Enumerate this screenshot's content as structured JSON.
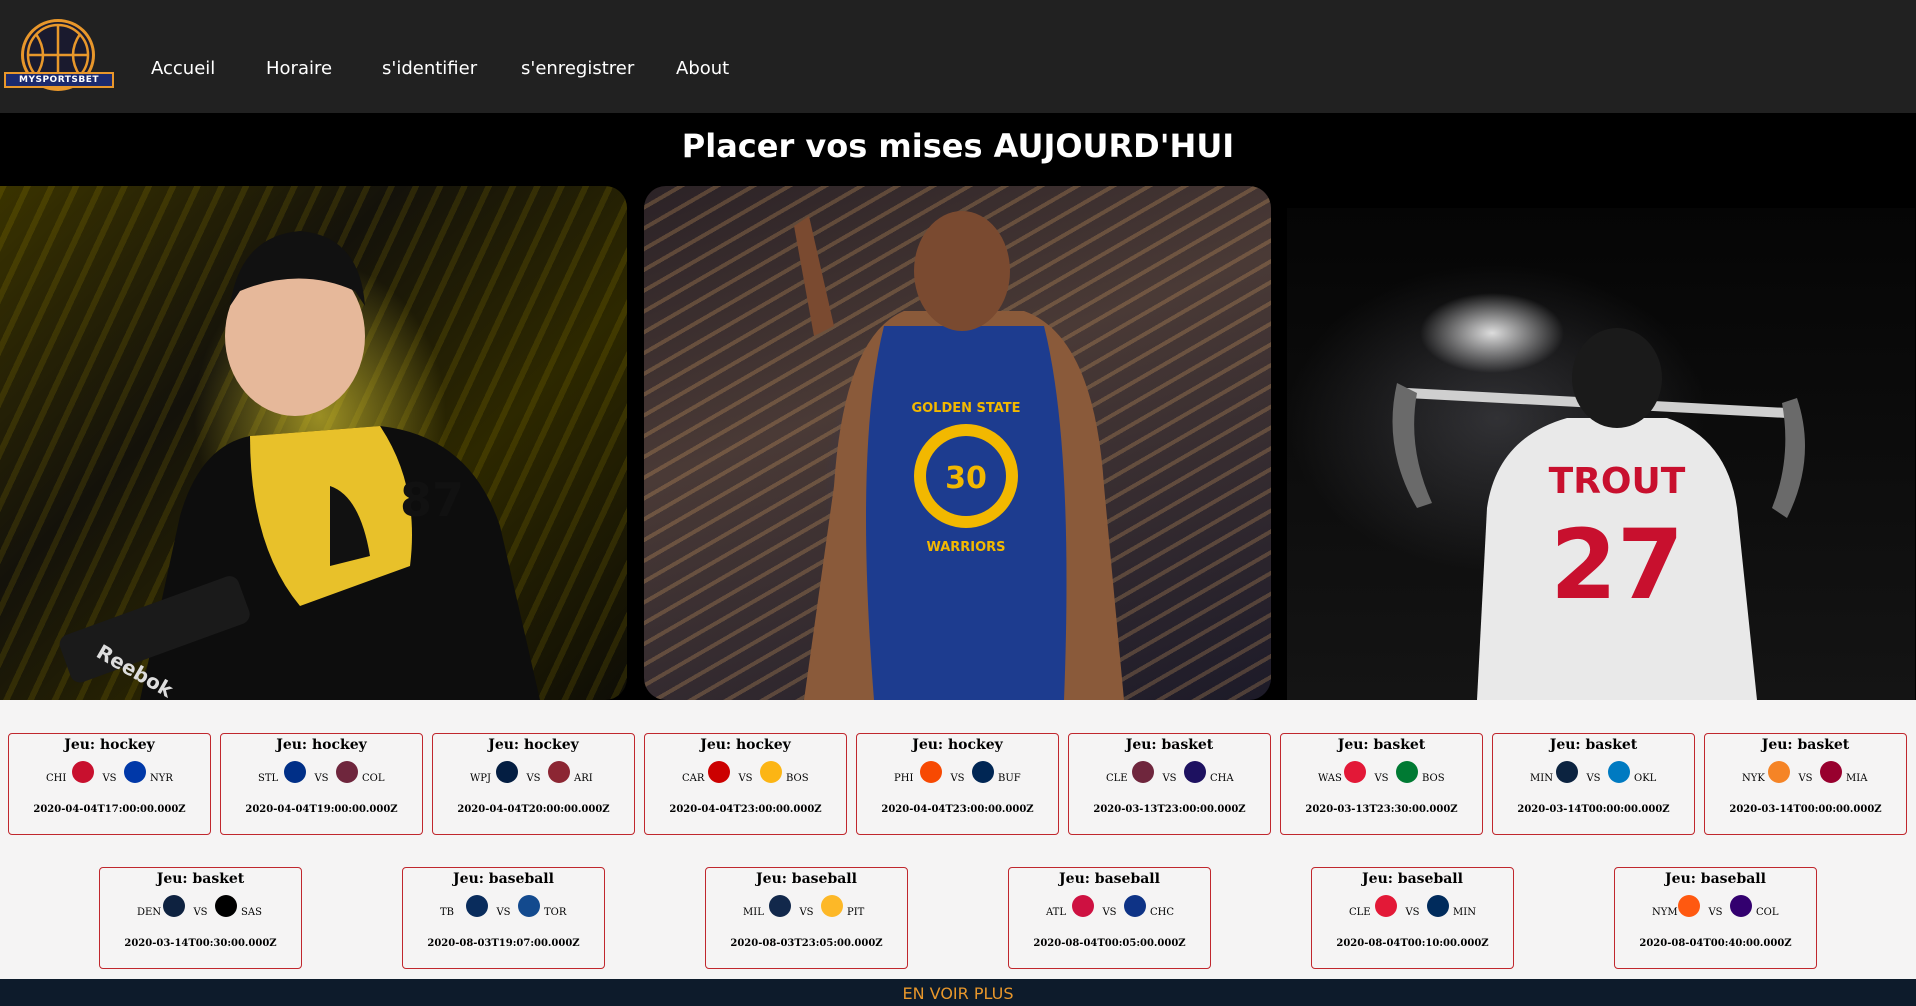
{
  "brand": {
    "logo_text": "MYSPORTSBET"
  },
  "nav": {
    "items": [
      {
        "label": "Accueil"
      },
      {
        "label": "Horaire"
      },
      {
        "label": "s'identifier"
      },
      {
        "label": "s'enregistrer"
      },
      {
        "label": "About"
      }
    ]
  },
  "hero": {
    "title": "Placer vos mises AUJOURD'HUI",
    "slide_texts": {
      "jersey_number_1": "87",
      "brand_1": "Reebok",
      "jersey_team_2": "GOLDEN STATE",
      "jersey_word_2": "WARRIORS",
      "jersey_number_2": "30",
      "jersey_name_3": "TROUT",
      "jersey_number_3": "27"
    }
  },
  "games": {
    "vs_label": "VS",
    "row1": [
      {
        "title": "Jeu: hockey",
        "home": "CHI",
        "away": "NYR",
        "date": "2020-04-04T17:00:00.000Z",
        "home_color": "#c8102e",
        "away_color": "#0038a8"
      },
      {
        "title": "Jeu: hockey",
        "home": "STL",
        "away": "COL",
        "date": "2020-04-04T19:00:00.000Z",
        "home_color": "#002f87",
        "away_color": "#6f263d"
      },
      {
        "title": "Jeu: hockey",
        "home": "WPJ",
        "away": "ARI",
        "date": "2020-04-04T20:00:00.000Z",
        "home_color": "#041e42",
        "away_color": "#8c2633"
      },
      {
        "title": "Jeu: hockey",
        "home": "CAR",
        "away": "BOS",
        "date": "2020-04-04T23:00:00.000Z",
        "home_color": "#cc0000",
        "away_color": "#fcb514"
      },
      {
        "title": "Jeu: hockey",
        "home": "PHI",
        "away": "BUF",
        "date": "2020-04-04T23:00:00.000Z",
        "home_color": "#f74902",
        "away_color": "#002654"
      },
      {
        "title": "Jeu: basket",
        "home": "CLE",
        "away": "CHA",
        "date": "2020-03-13T23:00:00.000Z",
        "home_color": "#6f263d",
        "away_color": "#1d1160"
      },
      {
        "title": "Jeu: basket",
        "home": "WAS",
        "away": "BOS",
        "date": "2020-03-13T23:30:00.000Z",
        "home_color": "#e31837",
        "away_color": "#007a33"
      },
      {
        "title": "Jeu: basket",
        "home": "MIN",
        "away": "OKL",
        "date": "2020-03-14T00:00:00.000Z",
        "home_color": "#0c2340",
        "away_color": "#007ac1"
      },
      {
        "title": "Jeu: basket",
        "home": "NYK",
        "away": "MIA",
        "date": "2020-03-14T00:00:00.000Z",
        "home_color": "#f58426",
        "away_color": "#98002e"
      }
    ],
    "row2": [
      {
        "title": "Jeu: basket",
        "home": "DEN",
        "away": "SAS",
        "date": "2020-03-14T00:30:00.000Z",
        "home_color": "#0e2240",
        "away_color": "#000000"
      },
      {
        "title": "Jeu: baseball",
        "home": "TB",
        "away": "TOR",
        "date": "2020-08-03T19:07:00.000Z",
        "home_color": "#092c5c",
        "away_color": "#134a8e"
      },
      {
        "title": "Jeu: baseball",
        "home": "MIL",
        "away": "PIT",
        "date": "2020-08-03T23:05:00.000Z",
        "home_color": "#12284b",
        "away_color": "#fdb827"
      },
      {
        "title": "Jeu: baseball",
        "home": "ATL",
        "away": "CHC",
        "date": "2020-08-04T00:05:00.000Z",
        "home_color": "#ce1141",
        "away_color": "#0e3386"
      },
      {
        "title": "Jeu: baseball",
        "home": "CLE",
        "away": "MIN",
        "date": "2020-08-04T00:10:00.000Z",
        "home_color": "#e31937",
        "away_color": "#002b5c"
      },
      {
        "title": "Jeu: baseball",
        "home": "NYM",
        "away": "COL",
        "date": "2020-08-04T00:40:00.000Z",
        "home_color": "#ff5910",
        "away_color": "#33006f"
      }
    ]
  },
  "more": {
    "label": "EN VOIR PLUS"
  }
}
